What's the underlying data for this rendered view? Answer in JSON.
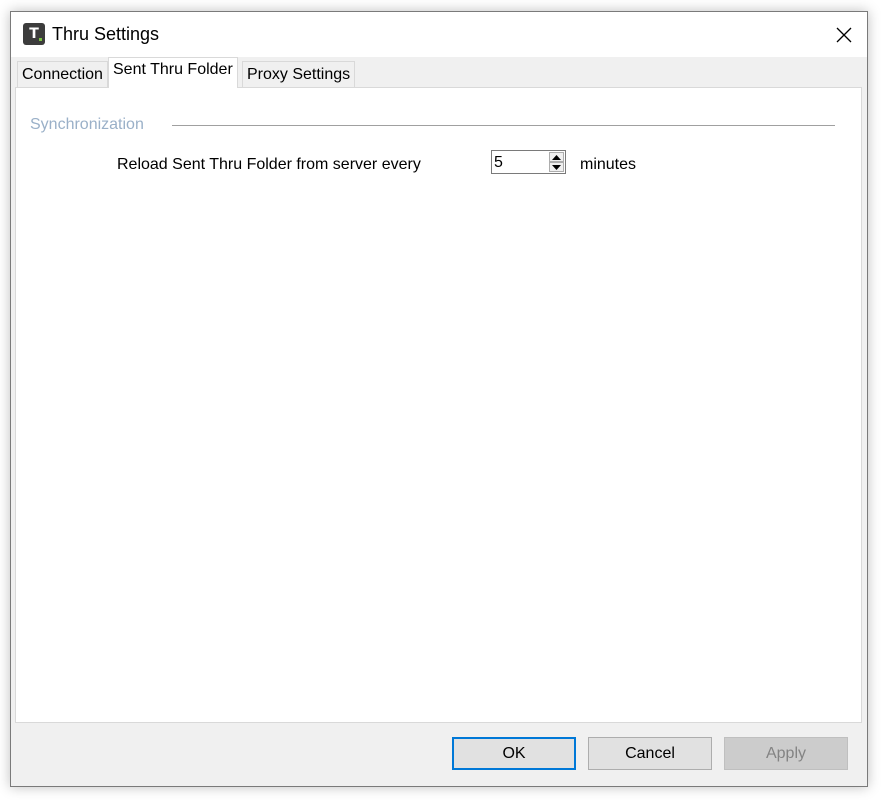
{
  "window": {
    "title": "Thru Settings",
    "app_icon_letter": "T",
    "close_icon": "close-icon"
  },
  "tabs": [
    {
      "label": "Connection",
      "active": false
    },
    {
      "label": "Sent Thru Folder",
      "active": true
    },
    {
      "label": "Proxy Settings",
      "active": false
    }
  ],
  "sync": {
    "group_label": "Synchronization",
    "reload_label": "Reload Sent Thru Folder from server every",
    "interval_value": "5",
    "unit_label": "minutes",
    "spin_up_icon": "arrow-up-icon",
    "spin_down_icon": "arrow-down-icon"
  },
  "buttons": {
    "ok": "OK",
    "cancel": "Cancel",
    "apply": "Apply",
    "apply_enabled": false
  },
  "colors": {
    "accent": "#0078d7",
    "group_label": "#9ab0c8",
    "dialog_bg": "#f0f0f0"
  }
}
